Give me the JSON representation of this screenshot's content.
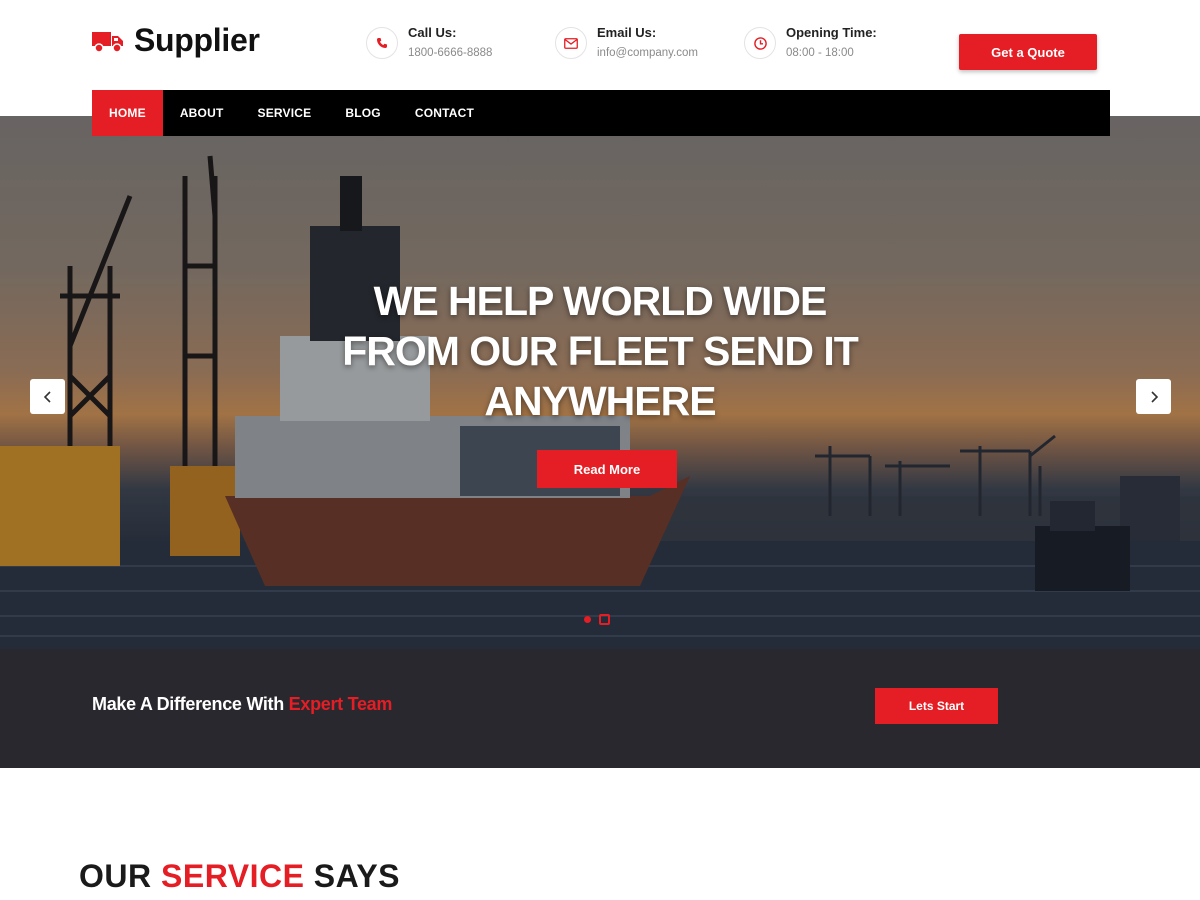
{
  "header": {
    "logo_text": "Supplier",
    "contacts": [
      {
        "label": "Call Us:",
        "value": "1800-6666-8888",
        "icon": "phone-icon"
      },
      {
        "label": "Email Us:",
        "value": "info@company.com",
        "icon": "mail-icon"
      },
      {
        "label": "Opening Time:",
        "value": "08:00 - 18:00",
        "icon": "clock-icon"
      }
    ],
    "quote_button": "Get a Quote"
  },
  "nav": {
    "items": [
      "HOME",
      "ABOUT",
      "SERVICE",
      "BLOG",
      "CONTACT"
    ],
    "active": "HOME"
  },
  "hero": {
    "headline_line1": "WE HELP WORLD WIDE",
    "headline_line2": "FROM OUR FLEET SEND IT",
    "headline_line3": "ANYWHERE",
    "button": "Read More",
    "prev_icon": "chevron-left-icon",
    "next_icon": "chevron-right-icon",
    "slide_count": 2,
    "active_slide": 2
  },
  "cta_band": {
    "text_plain": "Make A Difference With",
    "text_accent": "Expert Team",
    "button": "Lets Start"
  },
  "services": {
    "title_part1": "OUR",
    "title_part2": "SERVICE",
    "title_part3": "SAYS"
  },
  "colors": {
    "accent": "#e51d24",
    "nav_bg": "#000000",
    "band_bg": "#2a282f"
  }
}
